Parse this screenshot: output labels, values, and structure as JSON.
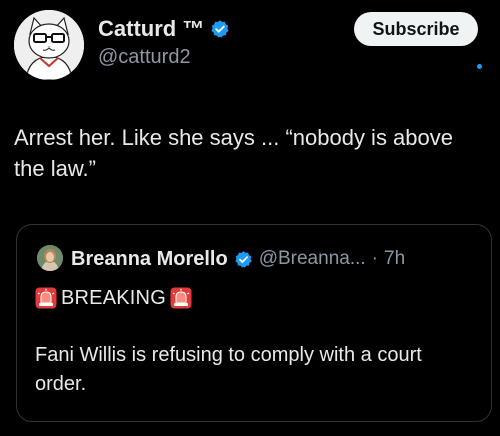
{
  "author": {
    "display_name": "Catturd ™",
    "handle": "@catturd2",
    "avatar_icon": "cat-with-glasses-avatar",
    "verified_icon": "verified-badge-icon"
  },
  "actions": {
    "subscribe_label": "Subscribe"
  },
  "post": {
    "text": "Arrest her. Like she says ... “nobody is above the law.”"
  },
  "quoted_post": {
    "display_name": "Breanna Morello",
    "handle": "@Breanna...",
    "separator": "·",
    "time": "7h",
    "breaking_text": "BREAKING",
    "siren_icon": "rotating-light-siren-emoji",
    "body": "Fani Willis is refusing to comply with a court order."
  },
  "colors": {
    "background": "#000000",
    "text": "#e7e9ea",
    "muted": "#8b98a5",
    "accent": "#1d9bf0",
    "border": "#2f3336",
    "button_bg": "#eff3f4"
  }
}
